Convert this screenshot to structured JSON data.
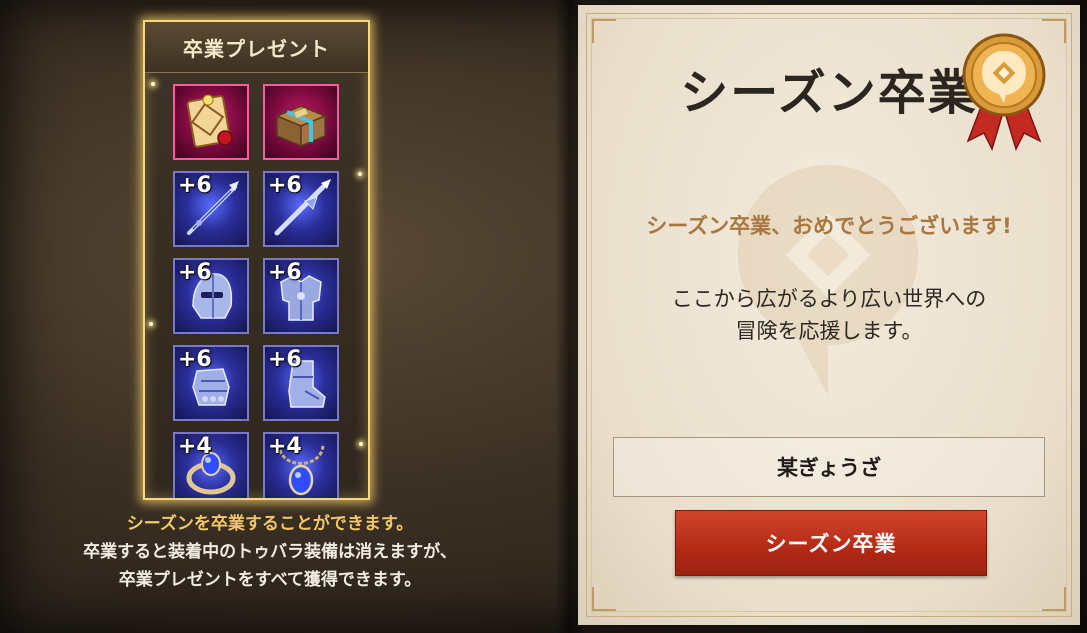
{
  "gift_panel": {
    "title": "卒業プレゼント",
    "items": [
      {
        "icon": "ticket-icon",
        "rarity": "pink",
        "plus": ""
      },
      {
        "icon": "treasure-chest-icon",
        "rarity": "pink",
        "plus": ""
      },
      {
        "icon": "spear-weapon-icon",
        "rarity": "blue",
        "plus": "+6"
      },
      {
        "icon": "lance-weapon-icon",
        "rarity": "blue",
        "plus": "+6"
      },
      {
        "icon": "helmet-icon",
        "rarity": "blue",
        "plus": "+6"
      },
      {
        "icon": "armor-icon",
        "rarity": "blue",
        "plus": "+6"
      },
      {
        "icon": "gauntlet-icon",
        "rarity": "blue",
        "plus": "+6"
      },
      {
        "icon": "boots-icon",
        "rarity": "blue",
        "plus": "+6"
      },
      {
        "icon": "ring-icon",
        "rarity": "blue",
        "plus": "+4"
      },
      {
        "icon": "necklace-icon",
        "rarity": "blue",
        "plus": "+4"
      }
    ]
  },
  "left_description": {
    "line1": "シーズンを卒業することができます。",
    "line2": "卒業すると装着中のトゥバラ装備は消えますが、",
    "line3": "卒業プレゼントをすべて獲得できます。"
  },
  "certificate": {
    "title": "シーズン卒業",
    "congrats": "シーズン卒業、おめでとうございます!",
    "message_line1": "ここから広がるより広い世界への",
    "message_line2": "冒険を応援します。",
    "player_name": "某ぎょうざ",
    "button_label": "シーズン卒業"
  },
  "colors": {
    "accent_gold": "#f2c868",
    "button_red": "#b22a16",
    "congrats_text": "#a9773f"
  }
}
